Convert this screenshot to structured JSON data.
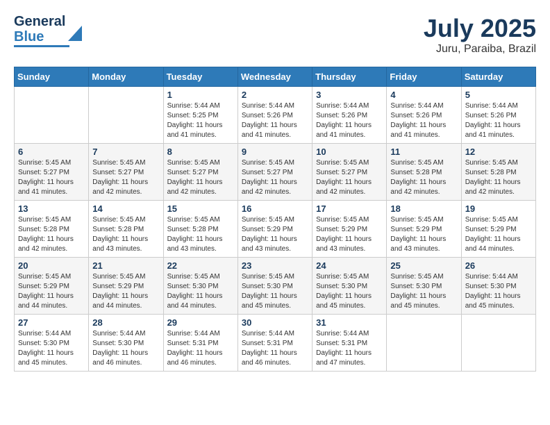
{
  "header": {
    "logo_line1": "General",
    "logo_line2": "Blue",
    "month": "July 2025",
    "location": "Juru, Paraiba, Brazil"
  },
  "weekdays": [
    "Sunday",
    "Monday",
    "Tuesday",
    "Wednesday",
    "Thursday",
    "Friday",
    "Saturday"
  ],
  "weeks": [
    [
      {
        "day": "",
        "info": ""
      },
      {
        "day": "",
        "info": ""
      },
      {
        "day": "1",
        "info": "Sunrise: 5:44 AM\nSunset: 5:25 PM\nDaylight: 11 hours and 41 minutes."
      },
      {
        "day": "2",
        "info": "Sunrise: 5:44 AM\nSunset: 5:26 PM\nDaylight: 11 hours and 41 minutes."
      },
      {
        "day": "3",
        "info": "Sunrise: 5:44 AM\nSunset: 5:26 PM\nDaylight: 11 hours and 41 minutes."
      },
      {
        "day": "4",
        "info": "Sunrise: 5:44 AM\nSunset: 5:26 PM\nDaylight: 11 hours and 41 minutes."
      },
      {
        "day": "5",
        "info": "Sunrise: 5:44 AM\nSunset: 5:26 PM\nDaylight: 11 hours and 41 minutes."
      }
    ],
    [
      {
        "day": "6",
        "info": "Sunrise: 5:45 AM\nSunset: 5:27 PM\nDaylight: 11 hours and 41 minutes."
      },
      {
        "day": "7",
        "info": "Sunrise: 5:45 AM\nSunset: 5:27 PM\nDaylight: 11 hours and 42 minutes."
      },
      {
        "day": "8",
        "info": "Sunrise: 5:45 AM\nSunset: 5:27 PM\nDaylight: 11 hours and 42 minutes."
      },
      {
        "day": "9",
        "info": "Sunrise: 5:45 AM\nSunset: 5:27 PM\nDaylight: 11 hours and 42 minutes."
      },
      {
        "day": "10",
        "info": "Sunrise: 5:45 AM\nSunset: 5:27 PM\nDaylight: 11 hours and 42 minutes."
      },
      {
        "day": "11",
        "info": "Sunrise: 5:45 AM\nSunset: 5:28 PM\nDaylight: 11 hours and 42 minutes."
      },
      {
        "day": "12",
        "info": "Sunrise: 5:45 AM\nSunset: 5:28 PM\nDaylight: 11 hours and 42 minutes."
      }
    ],
    [
      {
        "day": "13",
        "info": "Sunrise: 5:45 AM\nSunset: 5:28 PM\nDaylight: 11 hours and 42 minutes."
      },
      {
        "day": "14",
        "info": "Sunrise: 5:45 AM\nSunset: 5:28 PM\nDaylight: 11 hours and 43 minutes."
      },
      {
        "day": "15",
        "info": "Sunrise: 5:45 AM\nSunset: 5:28 PM\nDaylight: 11 hours and 43 minutes."
      },
      {
        "day": "16",
        "info": "Sunrise: 5:45 AM\nSunset: 5:29 PM\nDaylight: 11 hours and 43 minutes."
      },
      {
        "day": "17",
        "info": "Sunrise: 5:45 AM\nSunset: 5:29 PM\nDaylight: 11 hours and 43 minutes."
      },
      {
        "day": "18",
        "info": "Sunrise: 5:45 AM\nSunset: 5:29 PM\nDaylight: 11 hours and 43 minutes."
      },
      {
        "day": "19",
        "info": "Sunrise: 5:45 AM\nSunset: 5:29 PM\nDaylight: 11 hours and 44 minutes."
      }
    ],
    [
      {
        "day": "20",
        "info": "Sunrise: 5:45 AM\nSunset: 5:29 PM\nDaylight: 11 hours and 44 minutes."
      },
      {
        "day": "21",
        "info": "Sunrise: 5:45 AM\nSunset: 5:29 PM\nDaylight: 11 hours and 44 minutes."
      },
      {
        "day": "22",
        "info": "Sunrise: 5:45 AM\nSunset: 5:30 PM\nDaylight: 11 hours and 44 minutes."
      },
      {
        "day": "23",
        "info": "Sunrise: 5:45 AM\nSunset: 5:30 PM\nDaylight: 11 hours and 45 minutes."
      },
      {
        "day": "24",
        "info": "Sunrise: 5:45 AM\nSunset: 5:30 PM\nDaylight: 11 hours and 45 minutes."
      },
      {
        "day": "25",
        "info": "Sunrise: 5:45 AM\nSunset: 5:30 PM\nDaylight: 11 hours and 45 minutes."
      },
      {
        "day": "26",
        "info": "Sunrise: 5:44 AM\nSunset: 5:30 PM\nDaylight: 11 hours and 45 minutes."
      }
    ],
    [
      {
        "day": "27",
        "info": "Sunrise: 5:44 AM\nSunset: 5:30 PM\nDaylight: 11 hours and 45 minutes."
      },
      {
        "day": "28",
        "info": "Sunrise: 5:44 AM\nSunset: 5:30 PM\nDaylight: 11 hours and 46 minutes."
      },
      {
        "day": "29",
        "info": "Sunrise: 5:44 AM\nSunset: 5:31 PM\nDaylight: 11 hours and 46 minutes."
      },
      {
        "day": "30",
        "info": "Sunrise: 5:44 AM\nSunset: 5:31 PM\nDaylight: 11 hours and 46 minutes."
      },
      {
        "day": "31",
        "info": "Sunrise: 5:44 AM\nSunset: 5:31 PM\nDaylight: 11 hours and 47 minutes."
      },
      {
        "day": "",
        "info": ""
      },
      {
        "day": "",
        "info": ""
      }
    ]
  ]
}
